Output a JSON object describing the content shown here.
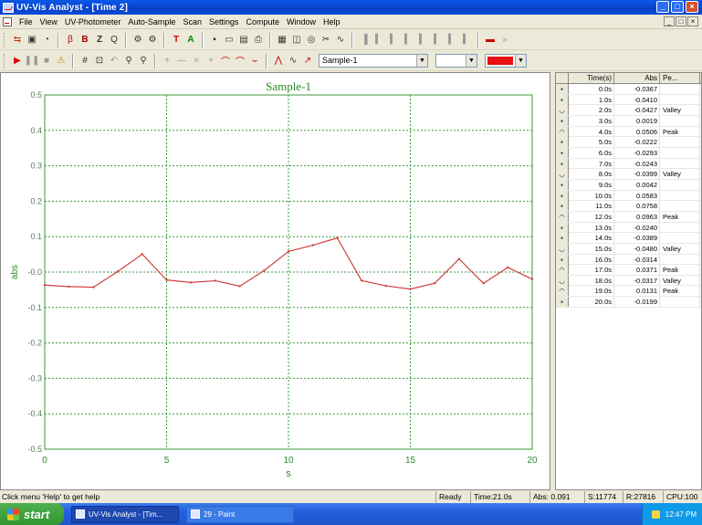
{
  "window": {
    "title": "UV-Vis Analyst - [Time 2]",
    "controls": [
      "_",
      "□",
      "×"
    ]
  },
  "menu": {
    "items": [
      "File",
      "View",
      "UV-Photometer",
      "Auto-Sample",
      "Scan",
      "Settings",
      "Compute",
      "Window",
      "Help"
    ],
    "mdi_controls": [
      "_",
      "□",
      "×"
    ]
  },
  "toolbar2": {
    "sample_select": "Sample-1",
    "empty_select": "",
    "color_select": "#e81010"
  },
  "chart_data": {
    "type": "line",
    "title": "Sample-1",
    "xlabel": "s",
    "ylabel": "abs",
    "xlim": [
      0,
      20
    ],
    "ylim": [
      -0.5,
      0.5
    ],
    "xticks": [
      "0",
      "5",
      "10",
      "15",
      "20"
    ],
    "yticks": [
      "0.5",
      "0.4",
      "0.3",
      "0.2",
      "0.1",
      "-0.0",
      "-0.1",
      "-0.2",
      "-0.3",
      "-0.4",
      "-0.5"
    ],
    "grid": true,
    "colors": {
      "line": "#d04040",
      "grid": "#3a9a3a",
      "title": "#2a8a2a",
      "axis": "#2a8a2a"
    },
    "series": [
      {
        "x": [
          0,
          1,
          2,
          3,
          4,
          5,
          6,
          7,
          8,
          9,
          10,
          11,
          12,
          13,
          14,
          15,
          16,
          17,
          18,
          19,
          20
        ],
        "values": [
          -0.0367,
          -0.041,
          -0.0427,
          0.0019,
          0.0506,
          -0.0222,
          -0.0293,
          -0.0243,
          -0.0399,
          0.0042,
          0.0583,
          0.0758,
          0.0963,
          -0.024,
          -0.0389,
          -0.048,
          -0.0314,
          0.0371,
          -0.0317,
          0.0131,
          -0.0199
        ]
      }
    ]
  },
  "table": {
    "headers": {
      "time": "Time(s)",
      "abs": "Abs",
      "peak": "Pe..."
    },
    "rows": [
      {
        "time": "0.0s",
        "abs": "-0.0367",
        "peak": ""
      },
      {
        "time": "1.0s",
        "abs": "-0.0410",
        "peak": ""
      },
      {
        "time": "2.0s",
        "abs": "-0.0427",
        "peak": "Valley"
      },
      {
        "time": "3.0s",
        "abs": "0.0019",
        "peak": ""
      },
      {
        "time": "4.0s",
        "abs": "0.0506",
        "peak": "Peak"
      },
      {
        "time": "5.0s",
        "abs": "-0.0222",
        "peak": ""
      },
      {
        "time": "6.0s",
        "abs": "-0.0293",
        "peak": ""
      },
      {
        "time": "7.0s",
        "abs": "-0.0243",
        "peak": ""
      },
      {
        "time": "8.0s",
        "abs": "-0.0399",
        "peak": "Valley"
      },
      {
        "time": "9.0s",
        "abs": "0.0042",
        "peak": ""
      },
      {
        "time": "10.0s",
        "abs": "0.0583",
        "peak": ""
      },
      {
        "time": "11.0s",
        "abs": "0.0758",
        "peak": ""
      },
      {
        "time": "12.0s",
        "abs": "0.0963",
        "peak": "Peak"
      },
      {
        "time": "13.0s",
        "abs": "-0.0240",
        "peak": ""
      },
      {
        "time": "14.0s",
        "abs": "-0.0389",
        "peak": ""
      },
      {
        "time": "15.0s",
        "abs": "-0.0480",
        "peak": "Valley"
      },
      {
        "time": "16.0s",
        "abs": "-0.0314",
        "peak": ""
      },
      {
        "time": "17.0s",
        "abs": "0.0371",
        "peak": "Peak"
      },
      {
        "time": "18.0s",
        "abs": "-0.0317",
        "peak": "Valley"
      },
      {
        "time": "19.0s",
        "abs": "0.0131",
        "peak": "Peak"
      },
      {
        "time": "20.0s",
        "abs": "-0.0199",
        "peak": ""
      }
    ]
  },
  "status": {
    "hint": "Click menu 'Help' to get help",
    "ready": "Ready",
    "time": "Time:21.0s",
    "abs": "Abs: 0.091",
    "s": "S:11774",
    "r": "R:27816",
    "cpu": "CPU:100"
  },
  "taskbar": {
    "start": "start",
    "tasks": [
      "UV-Vis Analyst - [Tim...",
      "29 - Paint"
    ],
    "clock": "12:47 PM"
  }
}
